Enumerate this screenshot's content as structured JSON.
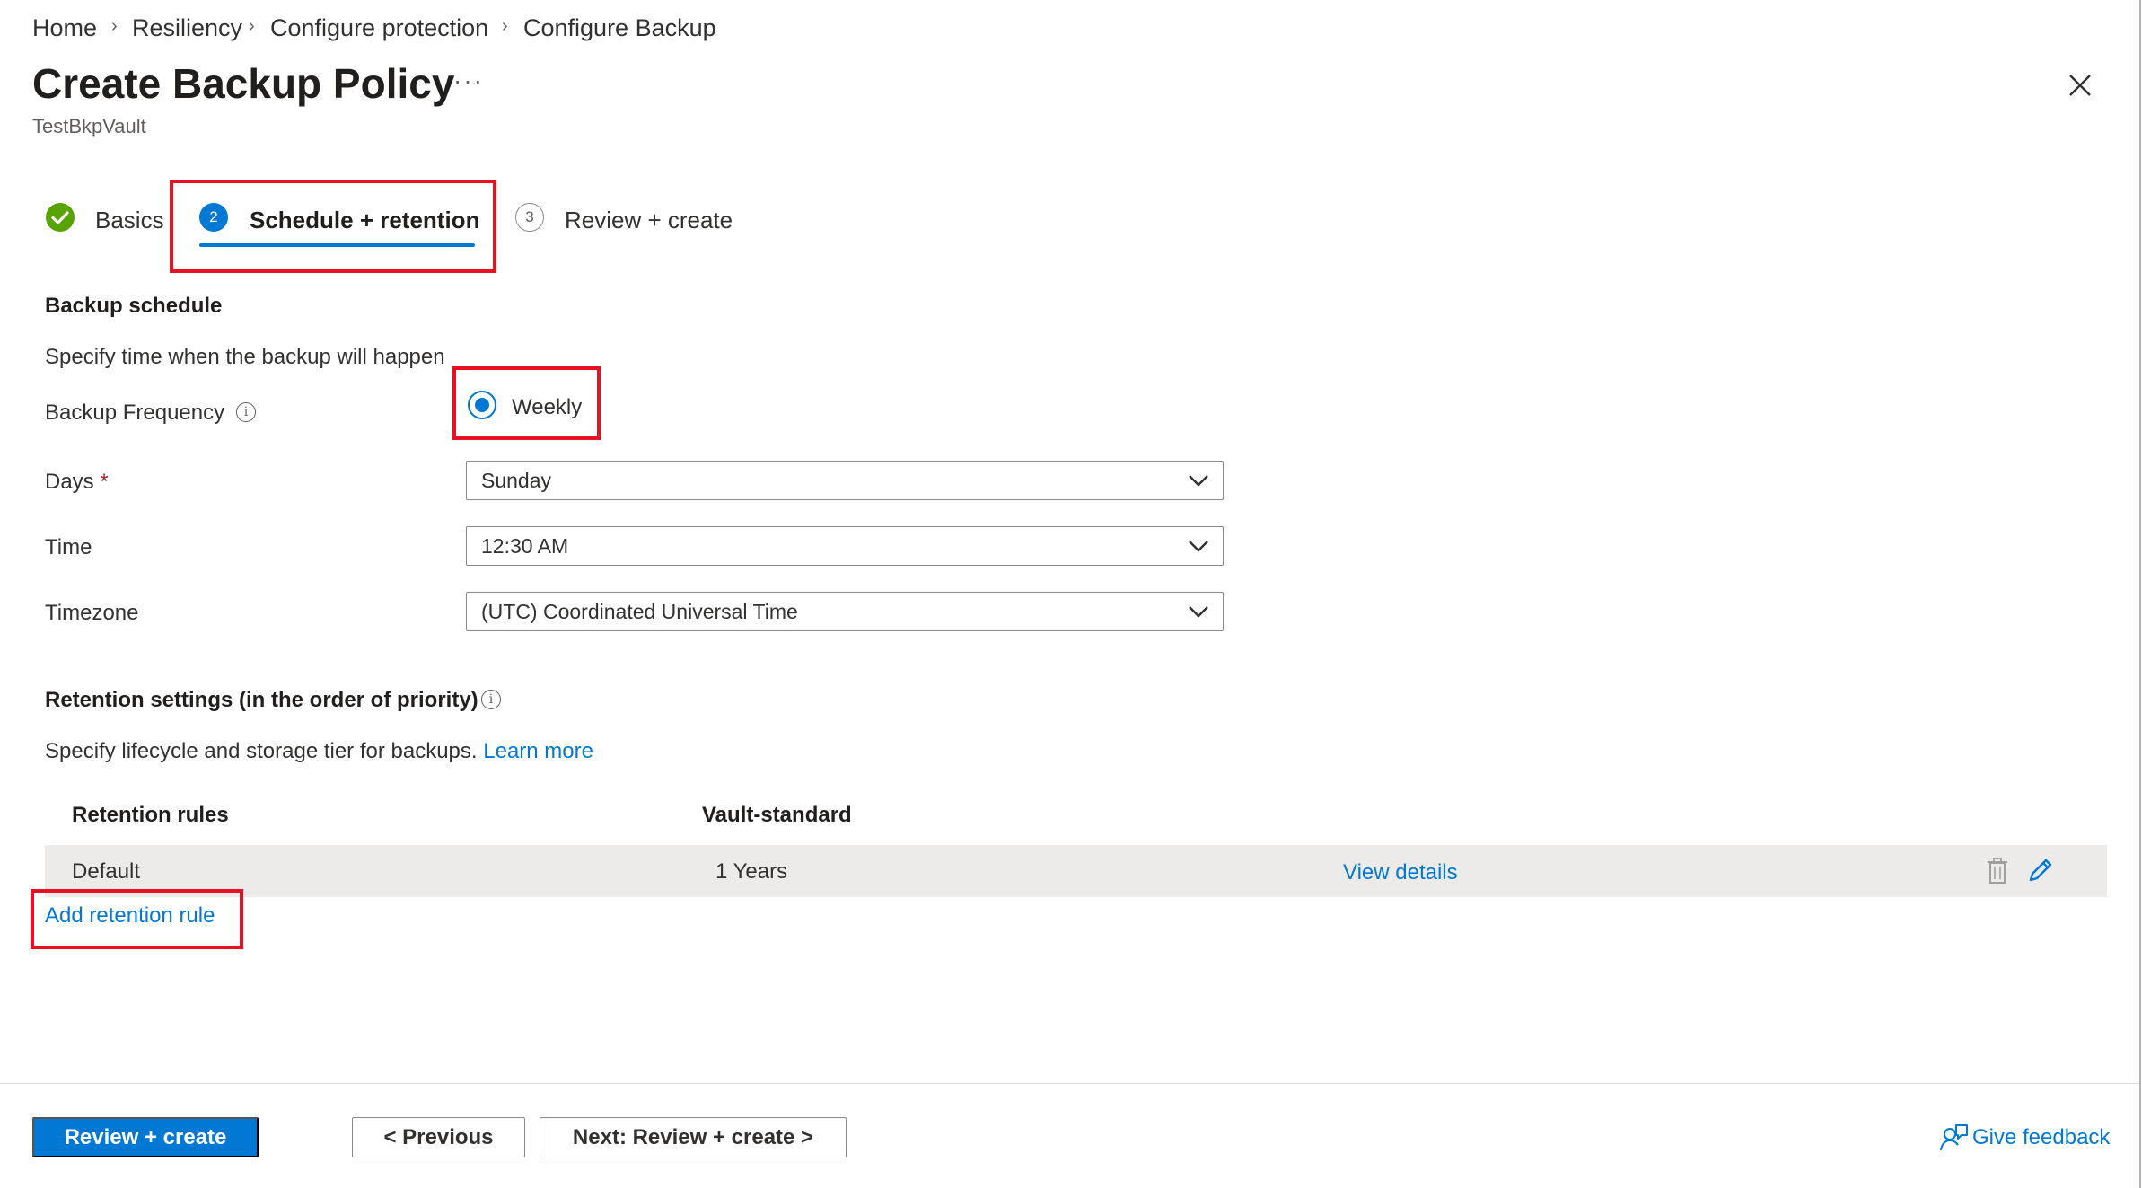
{
  "breadcrumb": {
    "items": [
      "Home",
      "Resiliency",
      "Configure protection",
      "Configure Backup"
    ],
    "separator": "›"
  },
  "header": {
    "title": "Create Backup Policy",
    "more": "···",
    "subtitle": "TestBkpVault",
    "close_icon": "close-icon"
  },
  "tabs": [
    {
      "label": "Basics",
      "state": "completed",
      "icon": "check-circle-icon"
    },
    {
      "label": "Schedule + retention",
      "state": "active",
      "number": "2"
    },
    {
      "label": "Review + create",
      "state": "pending",
      "number": "3"
    }
  ],
  "schedule": {
    "section_title": "Backup schedule",
    "description": "Specify time when the backup will happen",
    "frequency_label": "Backup Frequency",
    "frequency_option": "Weekly",
    "days_label": "Days",
    "required_mark": "*",
    "days_value": "Sunday",
    "time_label": "Time",
    "time_value": "12:30 AM",
    "timezone_label": "Timezone",
    "timezone_value": "(UTC) Coordinated Universal Time"
  },
  "retention": {
    "section_title": "Retention settings (in the order of priority)",
    "description": "Specify lifecycle and storage tier for backups.",
    "learn_more": "Learn more",
    "col_rules": "Retention rules",
    "col_vault": "Vault-standard",
    "rows": [
      {
        "rule": "Default",
        "duration": "1 Years",
        "link": "View details"
      }
    ],
    "add_rule": "Add retention rule"
  },
  "footer": {
    "review_create": "Review + create",
    "previous": "< Previous",
    "next": "Next: Review + create >",
    "feedback": "Give feedback"
  },
  "colors": {
    "accent": "#0078d4",
    "highlight_box": "#e81123",
    "success": "#57a300",
    "row_bg": "#edebe9"
  }
}
